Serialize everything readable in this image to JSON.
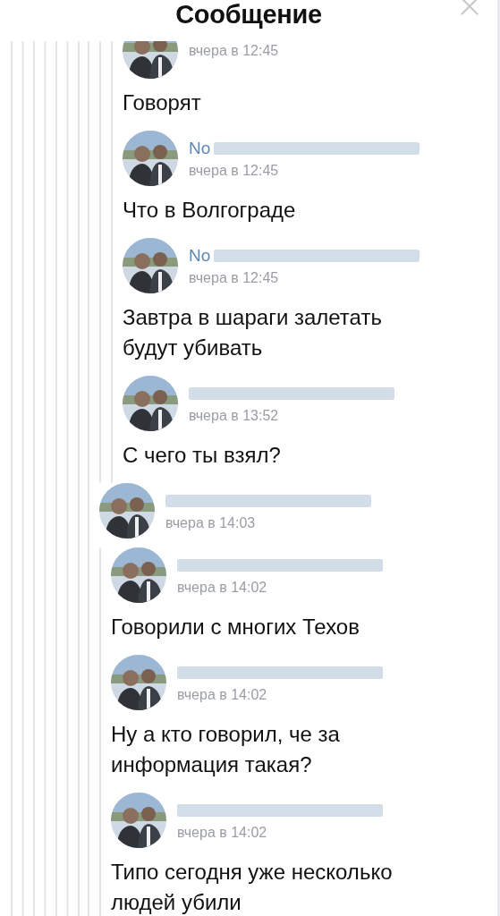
{
  "title": "Сообщение",
  "thread": [
    {
      "kind": "group",
      "children": [
        {
          "kind": "group",
          "children": [
            {
              "kind": "message",
              "time": "вчера в 12:45",
              "text": "Говорят"
            },
            {
              "kind": "message",
              "name": "No",
              "name_redacted": true,
              "time": "вчера в 12:45",
              "text": "Что в Волгограде"
            },
            {
              "kind": "message",
              "name": "No",
              "name_redacted": true,
              "time": "вчера в 12:45",
              "text": "Завтра в шараги залетать будут убивать"
            },
            {
              "kind": "message",
              "name_redacted": true,
              "time": "вчера в 13:52",
              "text": "С чего ты взял?"
            }
          ]
        }
      ]
    },
    {
      "kind": "message",
      "name_redacted": true,
      "time": "вчера в 14:03",
      "children": [
        {
          "kind": "message",
          "name_redacted": true,
          "time": "вчера в 14:02",
          "text": "Говорили с многих Техов"
        },
        {
          "kind": "message",
          "name_redacted": true,
          "time": "вчера в 14:02",
          "text": "Ну а кто говорил, че за информация такая?"
        },
        {
          "kind": "message",
          "name_redacted": true,
          "time": "вчера в 14:02",
          "text": "Типо сегодня уже несколько людей убили"
        }
      ]
    }
  ]
}
